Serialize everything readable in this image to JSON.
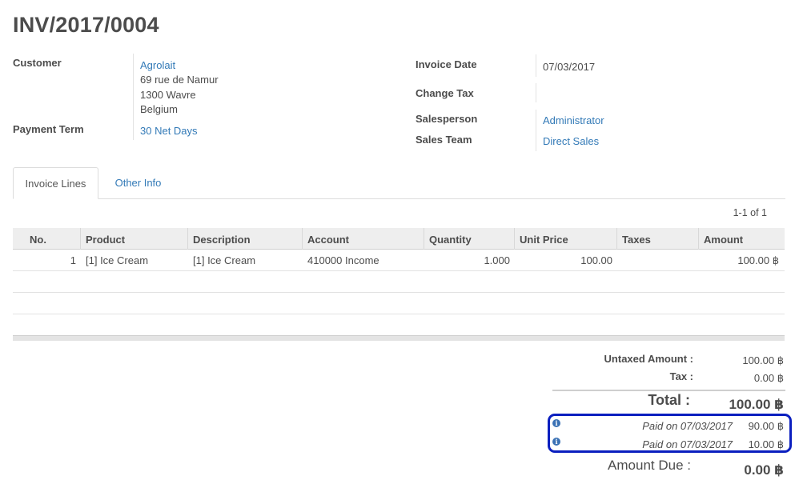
{
  "invoice": {
    "title": "INV/2017/0004"
  },
  "left_fields": {
    "customer_label": "Customer",
    "customer_name": "Agrolait",
    "address_line1": "69 rue de Namur",
    "address_line2": "1300 Wavre",
    "address_line3": "Belgium",
    "payment_term_label": "Payment Term",
    "payment_term_value": "30 Net Days"
  },
  "right_fields": {
    "invoice_date_label": "Invoice Date",
    "invoice_date_value": "07/03/2017",
    "change_tax_label": "Change Tax",
    "salesperson_label": "Salesperson",
    "salesperson_value": "Administrator",
    "sales_team_label": "Sales Team",
    "sales_team_value": "Direct Sales"
  },
  "tabs": [
    {
      "label": "Invoice Lines",
      "active": true
    },
    {
      "label": "Other Info",
      "active": false
    }
  ],
  "pager": "1-1 of 1",
  "table": {
    "columns": [
      "No.",
      "Product",
      "Description",
      "Account",
      "Quantity",
      "Unit Price",
      "Taxes",
      "Amount"
    ],
    "rows": [
      {
        "no": "1",
        "product": "[1] Ice Cream",
        "description": "[1] Ice Cream",
        "account": "410000 Income",
        "quantity": "1.000",
        "unit_price": "100.00",
        "taxes": "",
        "amount": "100.00 ฿"
      }
    ]
  },
  "totals": {
    "untaxed_label": "Untaxed Amount :",
    "untaxed_value": "100.00 ฿",
    "tax_label": "Tax :",
    "tax_value": "0.00 ฿",
    "total_label": "Total :",
    "total_value": "100.00 ฿",
    "payments": [
      {
        "label": "Paid on 07/03/2017",
        "value": "90.00 ฿"
      },
      {
        "label": "Paid on 07/03/2017",
        "value": "10.00 ฿"
      }
    ],
    "amount_due_label": "Amount Due :",
    "amount_due_value": "0.00 ฿"
  },
  "colors": {
    "link": "#337ab7",
    "highlight_box": "#0b1fbf",
    "info_icon": "#3b72b5"
  },
  "icons": {
    "payment_info": "info-circle-icon"
  }
}
